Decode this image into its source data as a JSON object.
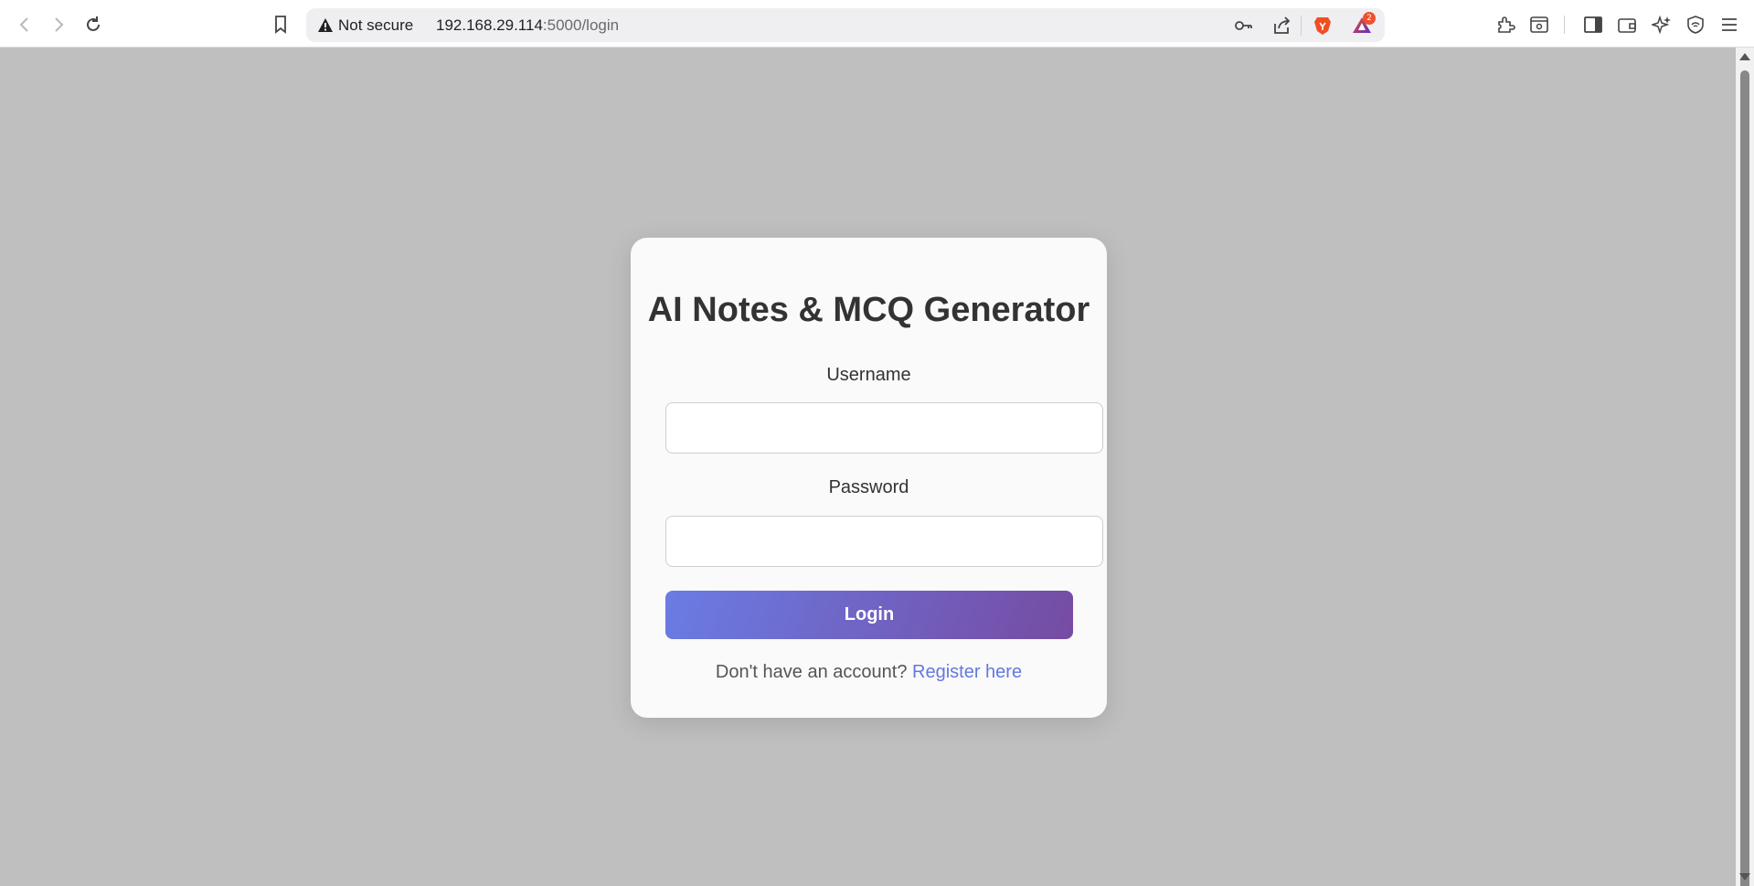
{
  "browser": {
    "security_label": "Not secure",
    "url_host": "192.168.29.114",
    "url_path": ":5000/login",
    "notification_count": "2",
    "icons": [
      "back-icon",
      "forward-icon",
      "reload-icon",
      "bookmark-icon",
      "warning-icon",
      "key-icon",
      "share-icon",
      "brave-shield-icon",
      "brave-rewards-icon",
      "extensions-icon",
      "reader-mode-icon",
      "sidebar-icon",
      "wallet-icon",
      "leo-ai-icon",
      "vpn-icon",
      "menu-icon"
    ]
  },
  "login": {
    "title": "AI Notes & MCQ Generator",
    "username_label": "Username",
    "username_value": "",
    "password_label": "Password",
    "password_value": "",
    "login_button": "Login",
    "footer_text": "Don't have an account?",
    "register_link": "Register here"
  },
  "colors": {
    "page_background": "#bfbfbf",
    "card_background": "#fafafa",
    "button_gradient_start": "#6a7ce4",
    "button_gradient_end": "#764ba2",
    "link": "#6478e0"
  }
}
